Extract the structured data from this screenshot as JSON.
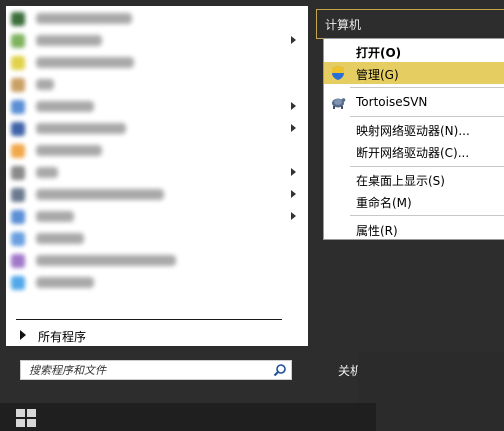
{
  "left_pane": {
    "programs": [
      {
        "icon": "program-icon",
        "color": "#3b6e3b",
        "label_width": 96,
        "has_submenu": false
      },
      {
        "icon": "program-icon",
        "color": "#7fb35f",
        "label_width": 66,
        "has_submenu": true
      },
      {
        "icon": "program-icon",
        "color": "#e0d24a",
        "label_width": 98,
        "has_submenu": false
      },
      {
        "icon": "program-icon",
        "color": "#c9a064",
        "label_width": 18,
        "has_submenu": false
      },
      {
        "icon": "program-icon",
        "color": "#5c8fd6",
        "label_width": 58,
        "has_submenu": true
      },
      {
        "icon": "program-icon",
        "color": "#3f63a8",
        "label_width": 90,
        "has_submenu": true
      },
      {
        "icon": "program-icon",
        "color": "#f0a84a",
        "label_width": 66,
        "has_submenu": false
      },
      {
        "icon": "program-icon",
        "color": "#8a8a8a",
        "label_width": 22,
        "has_submenu": true
      },
      {
        "icon": "program-icon",
        "color": "#6b7b8f",
        "label_width": 128,
        "has_submenu": true
      },
      {
        "icon": "program-icon",
        "color": "#5c8fd6",
        "label_width": 38,
        "has_submenu": true
      },
      {
        "icon": "program-icon",
        "color": "#6aa0e0",
        "label_width": 48,
        "has_submenu": false
      },
      {
        "icon": "program-icon",
        "color": "#a078c8",
        "label_width": 140,
        "has_submenu": false
      },
      {
        "icon": "program-icon",
        "color": "#52a8e8",
        "label_width": 58,
        "has_submenu": false
      }
    ],
    "all_programs_label": "所有程序"
  },
  "search": {
    "placeholder": "搜索程序和文件"
  },
  "shutdown": {
    "label": "关机"
  },
  "right_pane": {
    "header_label": "计算机"
  },
  "context_menu": {
    "items": [
      {
        "label": "打开(O)",
        "bold": true
      },
      {
        "label": "管理(G)",
        "highlight": true,
        "icon": "shield-icon"
      },
      {
        "label": "TortoiseSVN",
        "icon": "tortoise-icon"
      },
      {
        "label": "映射网络驱动器(N)..."
      },
      {
        "label": "断开网络驱动器(C)..."
      },
      {
        "label": "在桌面上显示(S)"
      },
      {
        "label": "重命名(M)"
      },
      {
        "label": "属性(R)"
      }
    ]
  },
  "colors": {
    "highlight": "#e6cd62",
    "menu_border": "#9a9a9a",
    "start_bg": "#2d2d2d",
    "header_border": "#c8a64a"
  }
}
